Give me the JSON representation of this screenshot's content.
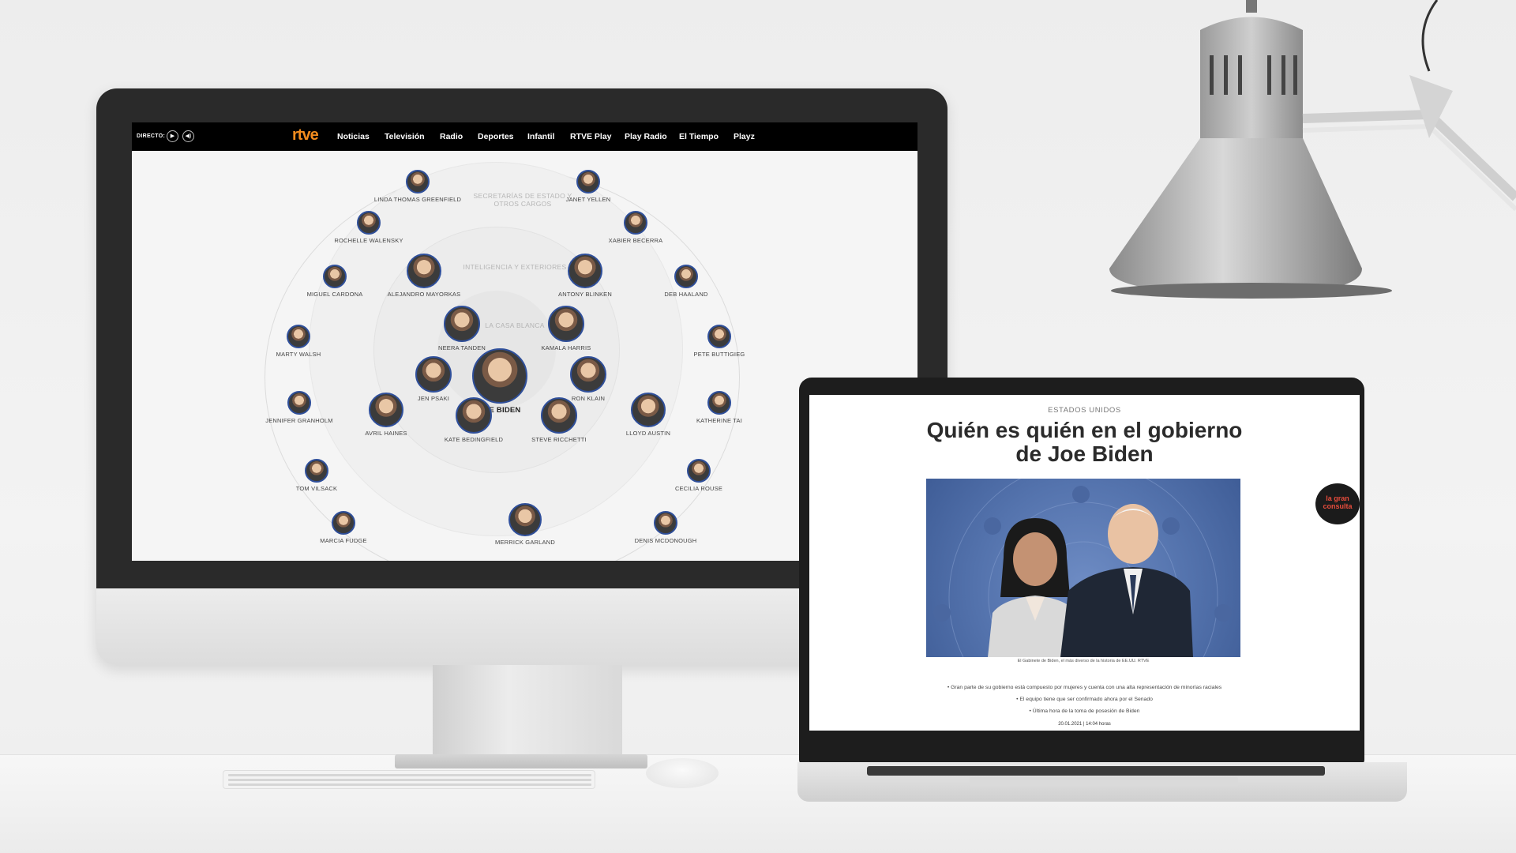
{
  "colors": {
    "rtve_orange": "#f28c1e",
    "avatar_ring": "#2f4f9a",
    "nav_bg": "#000000"
  },
  "desktop_site": {
    "directo_label": "DIRECTO:",
    "play_icon": "▶",
    "volume_icon": "◀)",
    "logo": "rtve",
    "nav": [
      "Noticias",
      "Televisión",
      "Radio",
      "Deportes",
      "Infantil",
      "RTVE Play",
      "Play Radio",
      "El Tiempo",
      "Playz"
    ],
    "rings": {
      "outer": "SECRETARÍAS DE ESTADO Y OTROS CARGOS",
      "middle": "INTELIGENCIA Y EXTERIORES",
      "inner": "LA CASA BLANCA"
    },
    "center": "JOE BIDEN",
    "people": [
      "LINDA THOMAS GREENFIELD",
      "JANET YELLEN",
      "ROCHELLE WALENSKY",
      "XABIER BECERRA",
      "MIGUEL CARDONA",
      "ALEJANDRO MAYORKAS",
      "ANTONY BLINKEN",
      "DEB HAALAND",
      "NEERA TANDEN",
      "KAMALA HARRIS",
      "MARTY WALSH",
      "PETE BUTTIGIEG",
      "JEN PSAKI",
      "RON KLAIN",
      "JENNIFER GRANHOLM",
      "KATHERINE TAI",
      "AVRIL HAINES",
      "KATE BEDINGFIELD",
      "STEVE RICCHETTI",
      "LLOYD AUSTIN",
      "TOM VILSACK",
      "CECILIA ROUSE",
      "MARCIA FUDGE",
      "MERRICK GARLAND",
      "DENIS MCDONOUGH"
    ]
  },
  "laptop_site": {
    "kicker": "ESTADOS UNIDOS",
    "title_line1": "Quién es quién en el gobierno",
    "title_line2": "de Joe Biden",
    "caption": "El Gabinete de Biden, el más diverso de la historia de EE.UU.   RTVE",
    "bullets": [
      "• Gran parte de su gobierno está compuesto por mujeres y cuenta con una alta representación de minorías raciales",
      "• El equipo tiene que ser confirmado ahora por el Senado",
      "• Última hora de la toma de posesión de Biden"
    ],
    "date": "20.01.2021 | 14:04 horas",
    "badge_line1": "la gran",
    "badge_line2": "consulta"
  }
}
